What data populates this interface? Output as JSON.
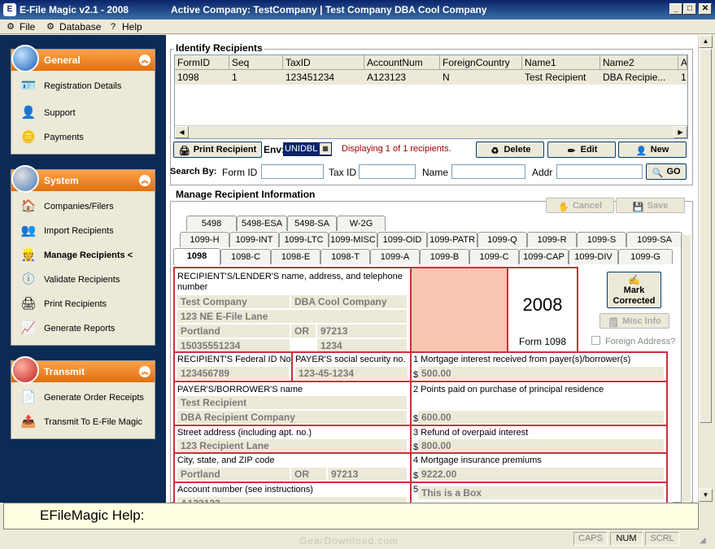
{
  "window": {
    "app_title": "E-File Magic v2.1 - 2008",
    "company_title": "Active Company: TestCompany  |  Test Company DBA Cool Company",
    "minimize": "_",
    "maximize": "□",
    "close": "✕"
  },
  "menu": [
    {
      "label": "File",
      "icon": "file-icon"
    },
    {
      "label": "Database",
      "icon": "database-icon"
    },
    {
      "label": "Help",
      "icon": "help-icon"
    }
  ],
  "sidebar": {
    "general": {
      "title": "General",
      "items": [
        "Registration Details",
        "Support",
        "Payments"
      ]
    },
    "system": {
      "title": "System",
      "items": [
        "Companies/Filers",
        "Import Recipients",
        "Manage Recipients <",
        "Validate Recipients",
        "Print Recipients",
        "Generate Reports"
      ]
    },
    "transmit": {
      "title": "Transmit",
      "items": [
        "Generate Order Receipts",
        "Transmit To E-File Magic"
      ]
    }
  },
  "identify": {
    "title": "Identify Recipients",
    "columns": [
      "FormID",
      "Seq",
      "TaxID",
      "AccountNum",
      "ForeignCountry",
      "Name1",
      "Name2",
      "A"
    ],
    "rows": [
      [
        "1098",
        "1",
        "123451234",
        "A123123",
        "N",
        "Test Recipient",
        "DBA Recipie...",
        "1"
      ]
    ],
    "print_button": "Print Recipient",
    "env_label": "Env:",
    "env_value": "UNIDBL",
    "displaying": "Displaying 1 of 1 recipients.",
    "delete_button": "Delete",
    "edit_button": "Edit",
    "new_button": "New",
    "search_by": "Search By:",
    "form_id_label": "Form ID",
    "tax_id_label": "Tax ID",
    "name_label": "Name",
    "addr_label": "Addr",
    "go_button": "GO"
  },
  "manage": {
    "title": "Manage Recipient Information",
    "cancel_button": "Cancel",
    "save_button": "Save",
    "tabs_row1": [
      "5498",
      "5498-ESA",
      "5498-SA",
      "W-2G"
    ],
    "tabs_row2": [
      "1099-H",
      "1099-INT",
      "1099-LTC",
      "1099-MISC",
      "1099-OID",
      "1099-PATR",
      "1099-Q",
      "1099-R",
      "1099-S",
      "1099-SA"
    ],
    "tabs_row3": [
      "1098",
      "1098-C",
      "1098-E",
      "1098-T",
      "1099-A",
      "1099-B",
      "1099-C",
      "1099-CAP",
      "1099-DIV",
      "1099-G"
    ],
    "selected_tab": "1098"
  },
  "form": {
    "lender_label": "RECIPIENT'S/LENDER'S name, address, and telephone number",
    "lender_name": "Test Company",
    "lender_dba": "DBA Cool Company",
    "lender_street": "123 NE E-File Lane",
    "lender_city": "Portland",
    "lender_state": "OR",
    "lender_zip": "97213",
    "lender_phone": "15035551234",
    "lender_ext": "1234",
    "year": "2008",
    "form_name": "Form 1098",
    "mark_corrected": "Mark Corrected",
    "misc_info": "Misc Info",
    "foreign_address": "Foreign Address?",
    "fed_id_label": "RECIPIENT'S Federal ID No.",
    "fed_id": "123456789",
    "payer_ssn_label": "PAYER'S social security no.",
    "payer_ssn": "123-45-1234",
    "box1_label": "1 Mortgage interest received from payer(s)/borrower(s)",
    "box1": "500.00",
    "payer_name_label": "PAYER'S/BORROWER'S name",
    "payer_name": "Test Recipient",
    "payer_dba": "DBA Recipient Company",
    "box2_label": "2 Points paid on purchase of principal residence",
    "box2": "600.00",
    "street_label": "Street address (including apt. no.)",
    "street": "123 Recipient Lane",
    "box3_label": "3 Refund of overpaid interest",
    "box3": "800.00",
    "city_label": "City, state, and ZIP code",
    "city": "Portland",
    "state": "OR",
    "zip": "97213",
    "box4_label": "4 Mortgage insurance premiums",
    "box4": "9222.00",
    "account_label": "Account number (see instructions)",
    "account": "A123123",
    "box5_label": "5",
    "box5": "This is a Box",
    "currency": "$"
  },
  "help": {
    "text": "EFileMagic Help:"
  },
  "status": {
    "caps": "CAPS",
    "num": "NUM",
    "scrl": "SCRL"
  },
  "watermark": "GearDownload.com"
}
